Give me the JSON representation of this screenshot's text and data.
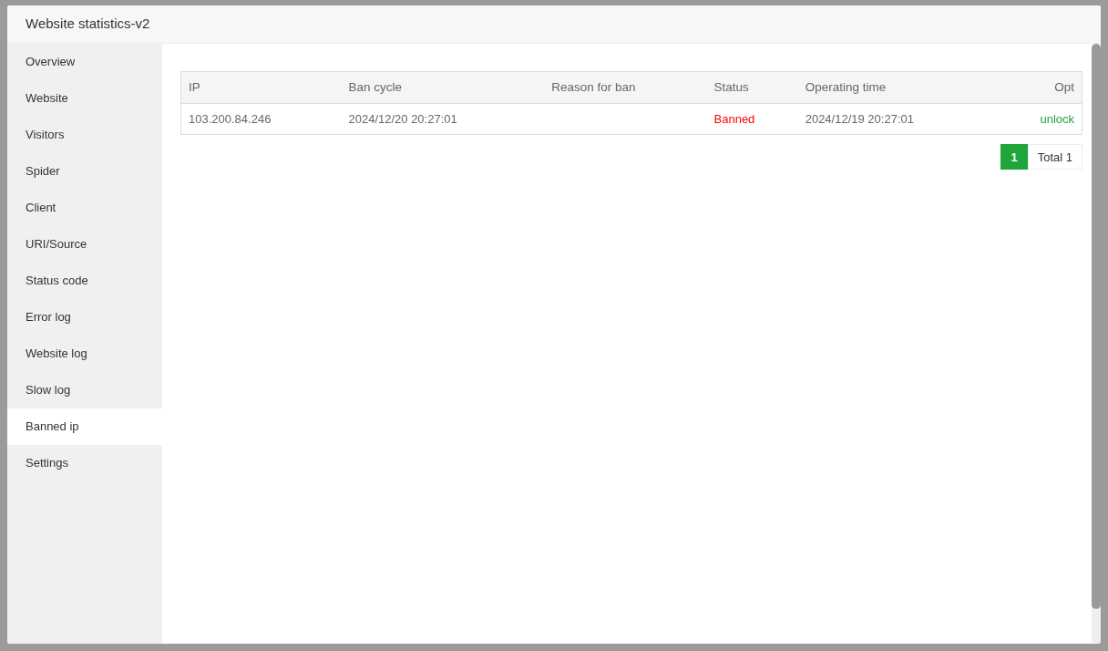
{
  "window": {
    "title": "Website statistics-v2"
  },
  "sidebar": {
    "items": [
      {
        "label": "Overview",
        "selected": false
      },
      {
        "label": "Website",
        "selected": false
      },
      {
        "label": "Visitors",
        "selected": false
      },
      {
        "label": "Spider",
        "selected": false
      },
      {
        "label": "Client",
        "selected": false
      },
      {
        "label": "URI/Source",
        "selected": false
      },
      {
        "label": "Status code",
        "selected": false
      },
      {
        "label": "Error log",
        "selected": false
      },
      {
        "label": "Website log",
        "selected": false
      },
      {
        "label": "Slow log",
        "selected": false
      },
      {
        "label": "Banned ip",
        "selected": true
      },
      {
        "label": "Settings",
        "selected": false
      }
    ]
  },
  "table": {
    "columns": [
      "IP",
      "Ban cycle",
      "Reason for ban",
      "Status",
      "Operating time",
      "Opt"
    ],
    "rows": [
      {
        "ip": "103.200.84.246",
        "ban_cycle": "2024/12/20 20:27:01",
        "status": "Banned",
        "banned": true,
        "operating_time": "2024/12/19 20:27:01",
        "action": "unlock"
      }
    ]
  },
  "pagination": {
    "pages": [
      {
        "label": "1",
        "selected": true
      }
    ],
    "total": "Total 1"
  }
}
